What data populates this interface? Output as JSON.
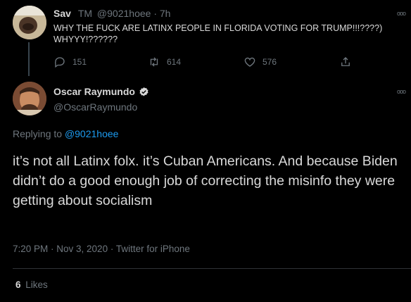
{
  "parent": {
    "name": "Sav",
    "tm": "TM",
    "handle": "@9021hoee",
    "time": "7h",
    "text": "WHY THE FUCK ARE LATINX PEOPLE IN FLORIDA VOTING FOR TRUMP!!!????) WHYYY!??????",
    "replies": "151",
    "retweets": "614",
    "likes": "576"
  },
  "main": {
    "name": "Oscar Raymundo",
    "handle": "@OscarRaymundo",
    "replying_prefix": "Replying to",
    "replying_to": "@9021hoee",
    "text": "it’s not all Latinx folx. it’s Cuban Americans. And because Biden didn’t do a good enough job of correcting the misinfo they were getting about socialism",
    "meta": "7:20 PM · Nov 3, 2020 · Twitter for iPhone",
    "likes_count": "6",
    "likes_label": "Likes",
    "verified_color": "#d9d9d9"
  },
  "icons": [
    "reply-icon",
    "retweet-icon",
    "like-icon",
    "share-icon",
    "more-options-icon",
    "verified-icon"
  ]
}
